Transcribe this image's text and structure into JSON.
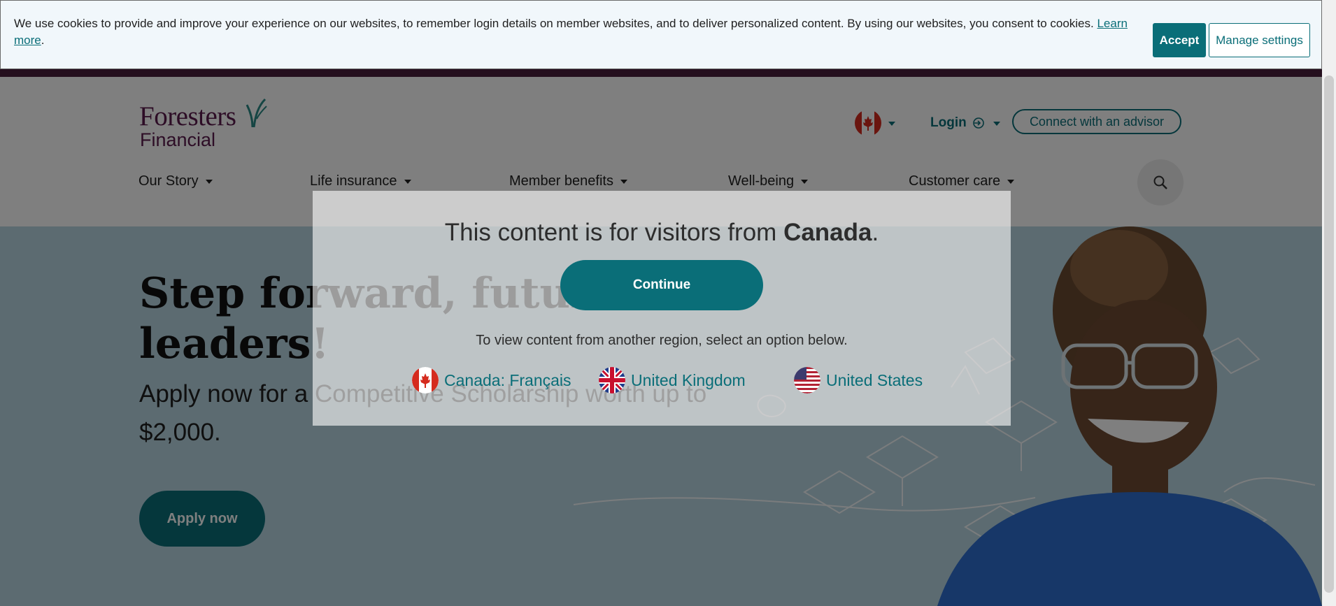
{
  "cookie_banner": {
    "text": "We use cookies to provide and improve your experience on our websites, to remember login details on member websites, and to deliver personalized content. By using our websites, you consent to cookies.",
    "learn_more": "Learn more",
    "trailing": ".",
    "accept": "Accept",
    "manage": "Manage settings"
  },
  "header": {
    "logo_line1": "Foresters",
    "logo_line2": "Financial",
    "login": "Login",
    "advisor": "Connect with an advisor",
    "nav": [
      "Our Story",
      "Life insurance",
      "Member benefits",
      "Well-being",
      "Customer care"
    ]
  },
  "hero": {
    "title": "Step forward, future leaders!",
    "subtitle": "Apply now for a Competitive Scholarship worth up to $2,000.",
    "cta": "Apply now"
  },
  "region_modal": {
    "title_prefix": "This content is for visitors from ",
    "title_country": "Canada",
    "title_suffix": ".",
    "continue": "Continue",
    "note": "To view content from another region, select an option below.",
    "options": [
      "Canada: Français",
      "United Kingdom",
      "United States"
    ]
  },
  "icons": {
    "flag": "canada-flag-icon",
    "login": "login-arrow-icon",
    "search": "search-icon"
  },
  "colors": {
    "brand_teal": "#0a6e78",
    "brand_plum": "#5b1a4d",
    "hero_bg": "#b9d6e3"
  }
}
